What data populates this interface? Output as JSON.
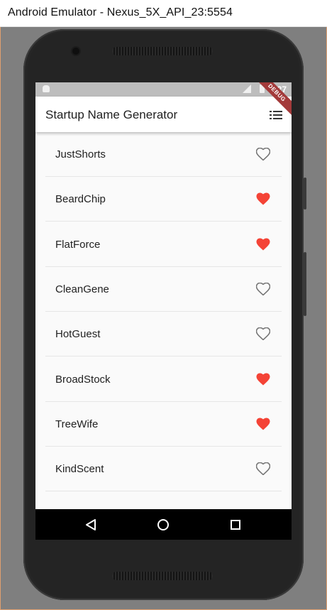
{
  "window": {
    "title": "Android Emulator - Nexus_5X_API_23:5554"
  },
  "status_bar": {
    "time": "7:27"
  },
  "app_bar": {
    "title": "Startup Name Generator",
    "action_icon": "list-icon"
  },
  "debug_banner": "DEBUG",
  "colors": {
    "favorite_heart": "#f44336",
    "unfavorite_heart": "#757575",
    "status_bar": "#bdbdbd",
    "nav_bar": "#000000"
  },
  "suggestions": [
    {
      "name": "JustShorts",
      "saved": false
    },
    {
      "name": "BeardChip",
      "saved": true
    },
    {
      "name": "FlatForce",
      "saved": true
    },
    {
      "name": "CleanGene",
      "saved": false
    },
    {
      "name": "HotGuest",
      "saved": false
    },
    {
      "name": "BroadStock",
      "saved": true
    },
    {
      "name": "TreeWife",
      "saved": true
    },
    {
      "name": "KindScent",
      "saved": false
    }
  ],
  "nav_bar": {
    "buttons": [
      "back-icon",
      "home-icon",
      "recents-icon"
    ]
  }
}
